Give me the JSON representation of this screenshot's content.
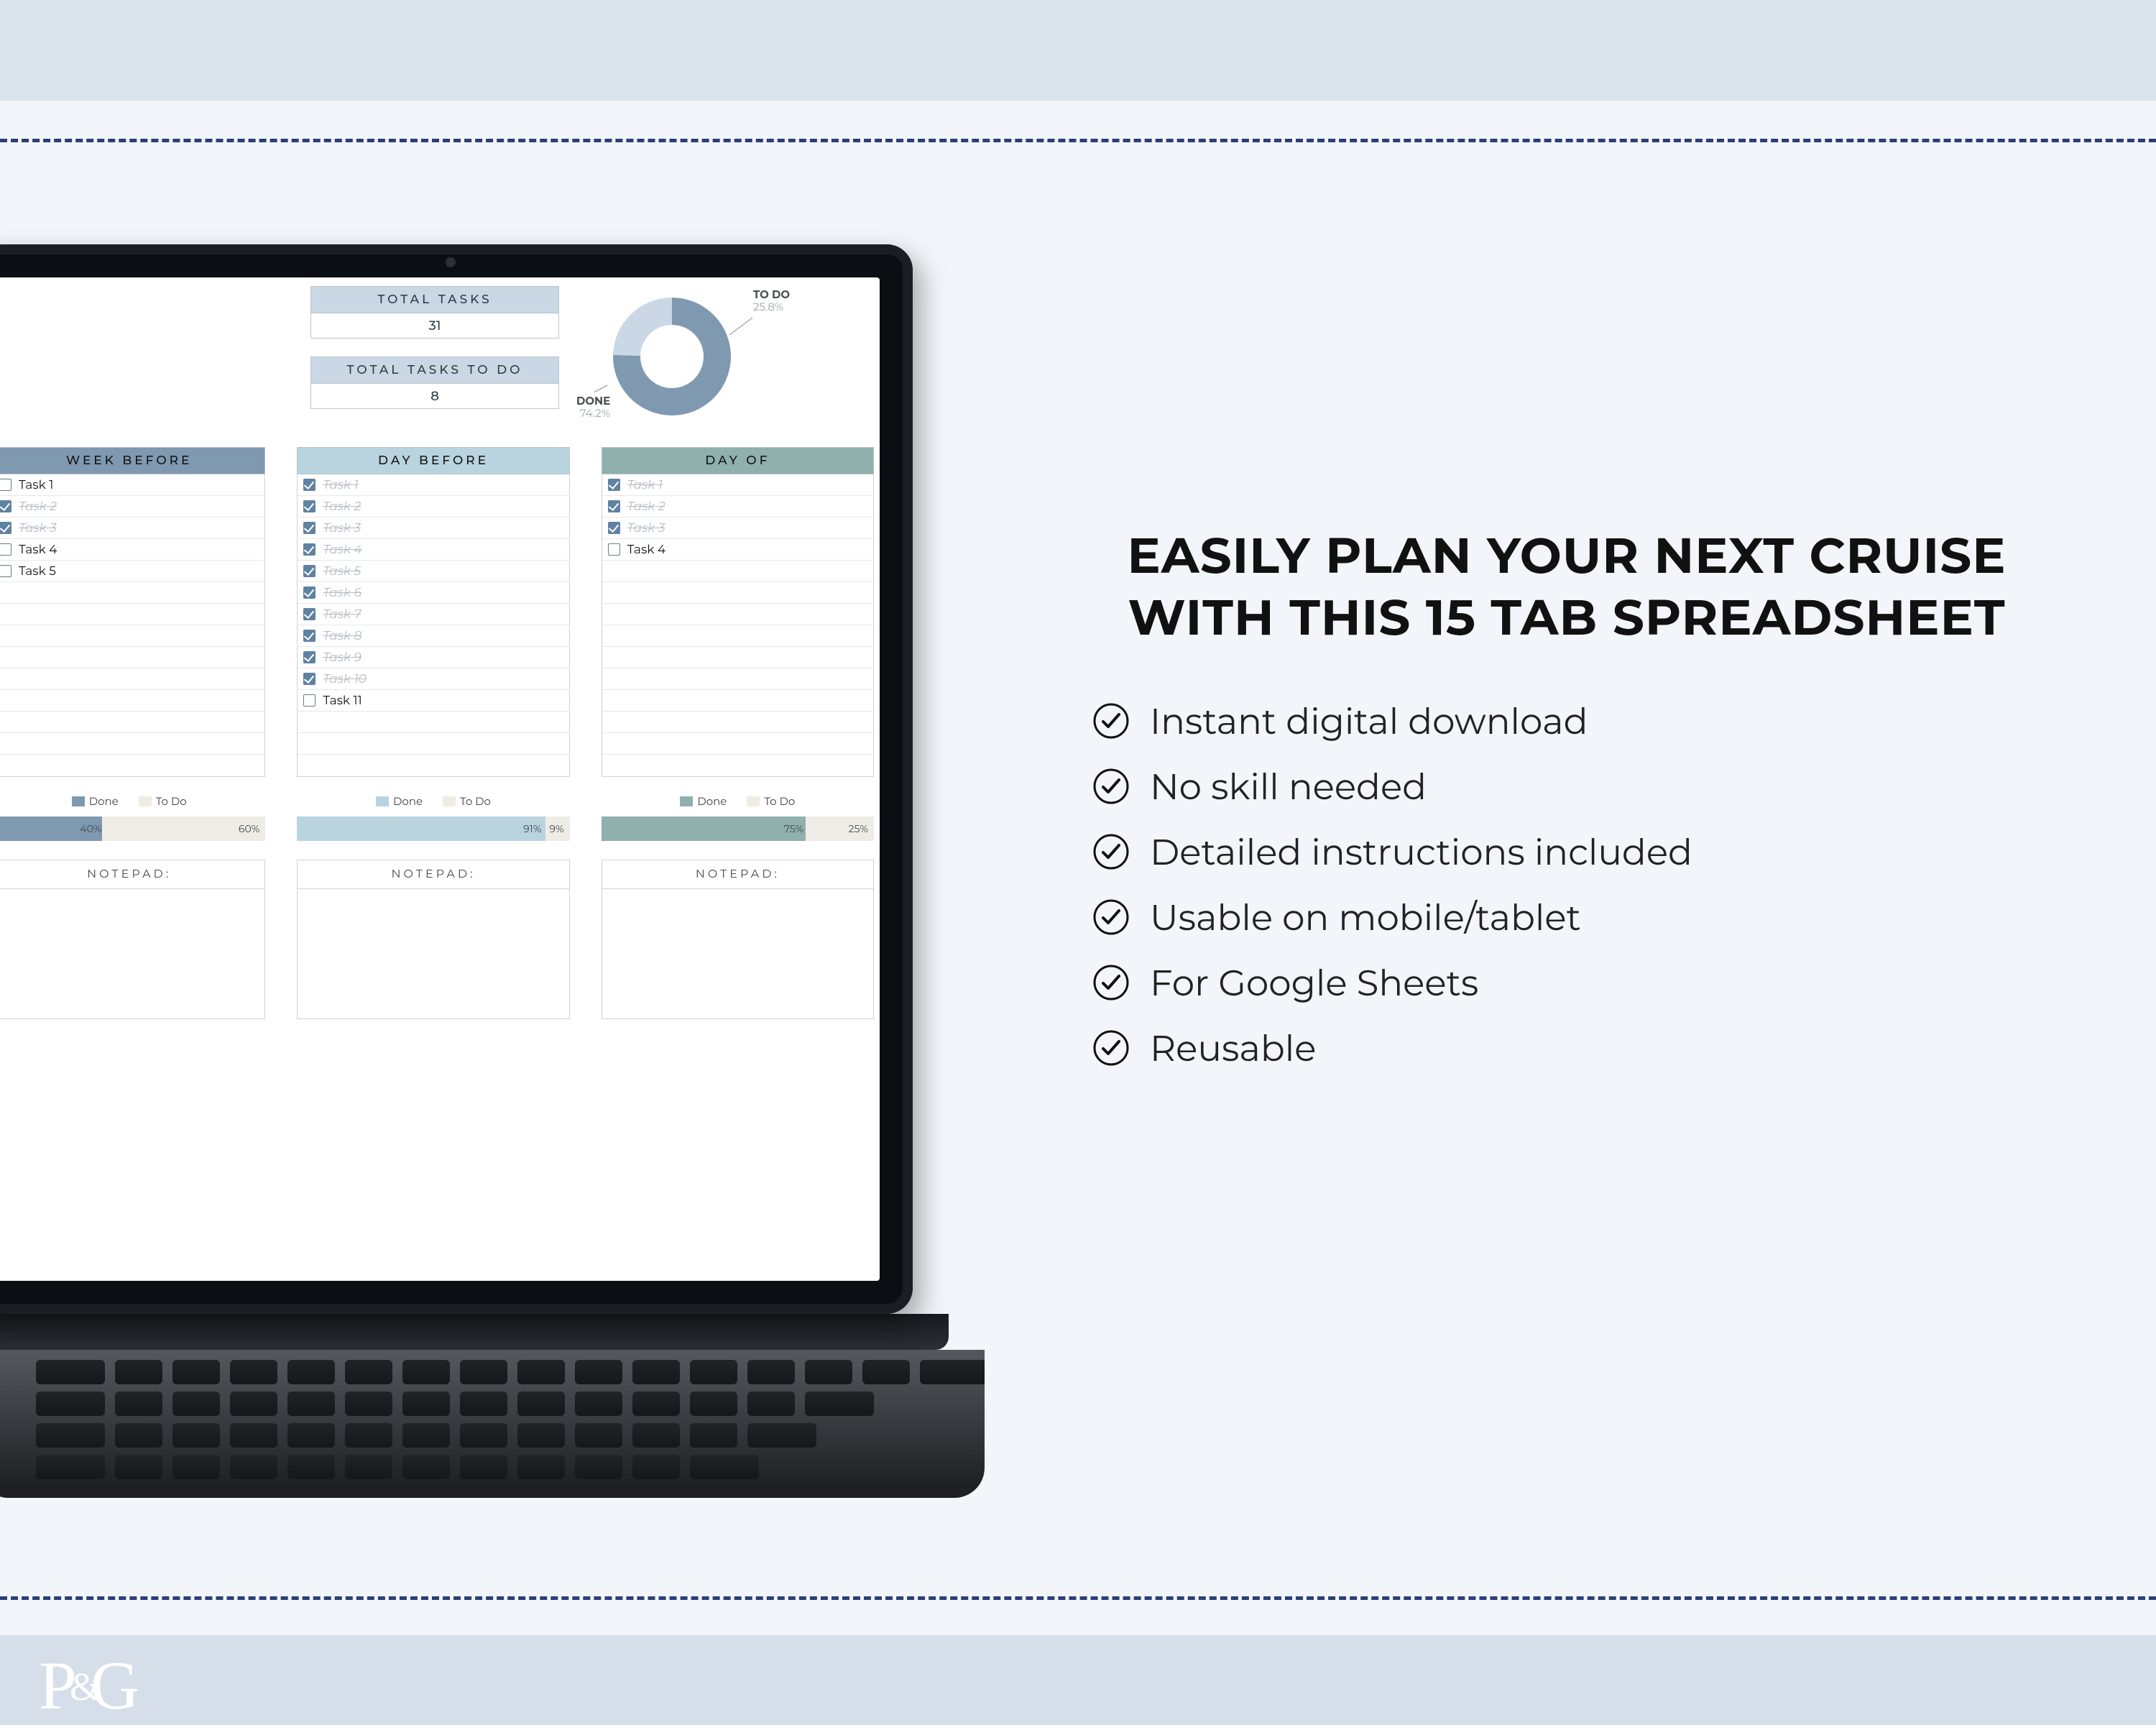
{
  "marketing": {
    "headline": "EASILY PLAN YOUR NEXT CRUISE WITH THIS 15 TAB SPREADSHEET",
    "features": [
      "Instant digital download",
      "No skill needed",
      "Detailed instructions included",
      "Usable on mobile/tablet",
      "For Google Sheets",
      "Reusable"
    ],
    "logo": "P&G"
  },
  "colors": {
    "week": "#7f99b0",
    "day_before": "#b9d4df",
    "day_of": "#7fa6a3",
    "todo_swatch": "#efece6"
  },
  "stats": {
    "total_label": "TOTAL TASKS",
    "total_value": "31",
    "todo_label": "TOTAL TASKS TO DO",
    "todo_value": "8"
  },
  "chart_data": {
    "type": "pie",
    "title": "",
    "series": [
      {
        "name": "DONE",
        "value": 74.2,
        "color": "#7f99b0"
      },
      {
        "name": "TO DO",
        "value": 25.8,
        "color": "#c9d8e4"
      }
    ],
    "labels": {
      "done": "DONE",
      "done_pct": "74.2%",
      "todo": "TO DO",
      "todo_pct": "25.8%"
    }
  },
  "columns": [
    {
      "title": "WEEK BEFORE",
      "header_bg": "#7f99b0",
      "legend_done": "Done",
      "legend_todo": "To Do",
      "done_pct": 40,
      "todo_pct": 60,
      "done_label": "40%",
      "todo_label": "60%",
      "notepad": "NOTEPAD:",
      "tasks": [
        {
          "label": "Task 1",
          "done": false
        },
        {
          "label": "Task 2",
          "done": true
        },
        {
          "label": "Task 3",
          "done": true
        },
        {
          "label": "Task 4",
          "done": false
        },
        {
          "label": "Task 5",
          "done": false
        }
      ],
      "blank_rows": 9
    },
    {
      "title": "DAY BEFORE",
      "header_bg": "#b9d4df",
      "legend_done": "Done",
      "legend_todo": "To Do",
      "done_pct": 91,
      "todo_pct": 9,
      "done_label": "91%",
      "todo_label": "9%",
      "notepad": "NOTEPAD:",
      "tasks": [
        {
          "label": "Task 1",
          "done": true
        },
        {
          "label": "Task 2",
          "done": true
        },
        {
          "label": "Task 3",
          "done": true
        },
        {
          "label": "Task 4",
          "done": true
        },
        {
          "label": "Task 5",
          "done": true
        },
        {
          "label": "Task 6",
          "done": true
        },
        {
          "label": "Task 7",
          "done": true
        },
        {
          "label": "Task 8",
          "done": true
        },
        {
          "label": "Task 9",
          "done": true
        },
        {
          "label": "Task 10",
          "done": true
        },
        {
          "label": "Task 11",
          "done": false
        }
      ],
      "blank_rows": 3
    },
    {
      "title": "DAY OF",
      "header_bg": "#8fb0ad",
      "legend_done": "Done",
      "legend_todo": "To Do",
      "done_pct": 75,
      "todo_pct": 25,
      "done_label": "75%",
      "todo_label": "25%",
      "notepad": "NOTEPAD:",
      "tasks": [
        {
          "label": "Task 1",
          "done": true
        },
        {
          "label": "Task 2",
          "done": true
        },
        {
          "label": "Task 3",
          "done": true
        },
        {
          "label": "Task 4",
          "done": false
        }
      ],
      "blank_rows": 10
    }
  ]
}
